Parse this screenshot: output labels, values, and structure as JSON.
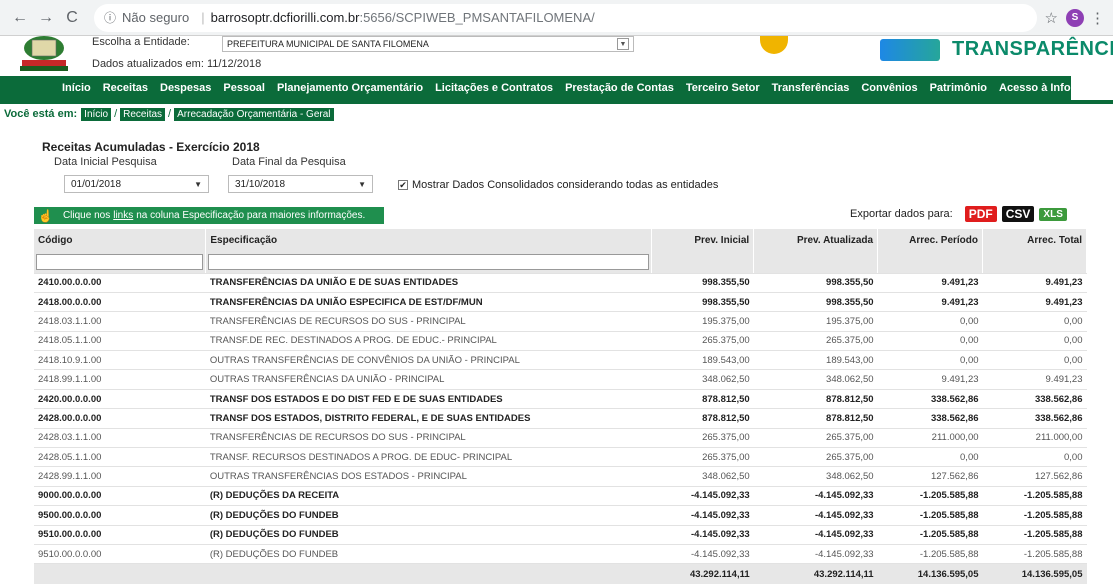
{
  "browser": {
    "security": "Não seguro",
    "host": "barrosoptr.dcfiorilli.com.br",
    "path": ":5656/SCPIWEB_PMSANTAFILOMENA/",
    "profile_initial": "S"
  },
  "header": {
    "entity_label": "Escolha a Entidade:",
    "entity_value": "PREFEITURA MUNICIPAL DE SANTA FILOMENA",
    "updated": "Dados atualizados em: 11/12/2018",
    "brand": "TRANSPARÊNCIA"
  },
  "nav": [
    "Início",
    "Receitas",
    "Despesas",
    "Pessoal",
    "Planejamento Orçamentário",
    "Licitações e Contratos",
    "Prestação de Contas",
    "Terceiro Setor",
    "Transferências",
    "Convênios",
    "Patrimônio",
    "Acesso à Informação"
  ],
  "breadcrumb": {
    "label": "Você está em:",
    "items": [
      "Início",
      "Receitas",
      "Arrecadação Orçamentária - Geral"
    ]
  },
  "filters": {
    "title": "Receitas Acumuladas - Exercício 2018",
    "start_label": "Data Inicial Pesquisa",
    "start_value": "01/01/2018",
    "end_label": "Data Final da Pesquisa",
    "end_value": "31/10/2018",
    "consolidated": "Mostrar Dados Consolidados considerando todas as entidades"
  },
  "hint": {
    "before": "Clique nos",
    "link": "links",
    "after": "na coluna Especificação para maiores informações."
  },
  "export": {
    "label": "Exportar dados para:",
    "pdf": "PDF",
    "csv": "CSV",
    "xls": "XLS"
  },
  "table": {
    "columns": [
      "Código",
      "Especificação",
      "Prev. Inicial",
      "Prev. Atualizada",
      "Arrec. Período",
      "Arrec. Total"
    ],
    "rows": [
      {
        "bold": true,
        "cells": [
          "2410.00.0.0.00",
          "TRANSFERÊNCIAS DA UNIÃO E DE SUAS ENTIDADES",
          "998.355,50",
          "998.355,50",
          "9.491,23",
          "9.491,23"
        ]
      },
      {
        "bold": true,
        "cells": [
          "2418.00.0.0.00",
          "TRANSFERÊNCIAS DA UNIÃO ESPECIFICA DE EST/DF/MUN",
          "998.355,50",
          "998.355,50",
          "9.491,23",
          "9.491,23"
        ]
      },
      {
        "bold": false,
        "cells": [
          "2418.03.1.1.00",
          "TRANSFERÊNCIAS DE RECURSOS DO SUS - PRINCIPAL",
          "195.375,00",
          "195.375,00",
          "0,00",
          "0,00"
        ]
      },
      {
        "bold": false,
        "cells": [
          "2418.05.1.1.00",
          "TRANSF.DE REC. DESTINADOS A PROG. DE EDUC.- PRINCIPAL",
          "265.375,00",
          "265.375,00",
          "0,00",
          "0,00"
        ]
      },
      {
        "bold": false,
        "cells": [
          "2418.10.9.1.00",
          "OUTRAS TRANSFERÊNCIAS DE CONVÊNIOS DA UNIÃO - PRINCIPAL",
          "189.543,00",
          "189.543,00",
          "0,00",
          "0,00"
        ]
      },
      {
        "bold": false,
        "cells": [
          "2418.99.1.1.00",
          "OUTRAS TRANSFERÊNCIAS DA UNIÃO - PRINCIPAL",
          "348.062,50",
          "348.062,50",
          "9.491,23",
          "9.491,23"
        ]
      },
      {
        "bold": true,
        "cells": [
          "2420.00.0.0.00",
          "TRANSF DOS ESTADOS E DO DIST FED E DE SUAS ENTIDADES",
          "878.812,50",
          "878.812,50",
          "338.562,86",
          "338.562,86"
        ]
      },
      {
        "bold": true,
        "cells": [
          "2428.00.0.0.00",
          "TRANSF DOS ESTADOS, DISTRITO FEDERAL, E DE SUAS ENTIDADES",
          "878.812,50",
          "878.812,50",
          "338.562,86",
          "338.562,86"
        ]
      },
      {
        "bold": false,
        "cells": [
          "2428.03.1.1.00",
          "TRANSFERÊNCIAS DE RECURSOS DO SUS - PRINCIPAL",
          "265.375,00",
          "265.375,00",
          "211.000,00",
          "211.000,00"
        ]
      },
      {
        "bold": false,
        "cells": [
          "2428.05.1.1.00",
          "TRANSF. RECURSOS DESTINADOS A PROG. DE EDUC- PRINCIPAL",
          "265.375,00",
          "265.375,00",
          "0,00",
          "0,00"
        ]
      },
      {
        "bold": false,
        "cells": [
          "2428.99.1.1.00",
          "OUTRAS TRANSFERÊNCIAS DOS ESTADOS - PRINCIPAL",
          "348.062,50",
          "348.062,50",
          "127.562,86",
          "127.562,86"
        ]
      },
      {
        "bold": true,
        "cells": [
          "9000.00.0.0.00",
          "(R) DEDUÇÕES DA RECEITA",
          "-4.145.092,33",
          "-4.145.092,33",
          "-1.205.585,88",
          "-1.205.585,88"
        ]
      },
      {
        "bold": true,
        "cells": [
          "9500.00.0.0.00",
          "(R) DEDUÇÕES DO FUNDEB",
          "-4.145.092,33",
          "-4.145.092,33",
          "-1.205.585,88",
          "-1.205.585,88"
        ]
      },
      {
        "bold": true,
        "cells": [
          "9510.00.0.0.00",
          "(R) DEDUÇÕES DO FUNDEB",
          "-4.145.092,33",
          "-4.145.092,33",
          "-1.205.585,88",
          "-1.205.585,88"
        ]
      },
      {
        "bold": false,
        "cells": [
          "9510.00.0.0.00",
          "(R) DEDUÇÕES DO FUNDEB",
          "-4.145.092,33",
          "-4.145.092,33",
          "-1.205.585,88",
          "-1.205.585,88"
        ]
      }
    ],
    "totals": [
      "",
      "",
      "43.292.114,11",
      "43.292.114,11",
      "14.136.595,05",
      "14.136.595,05"
    ]
  }
}
